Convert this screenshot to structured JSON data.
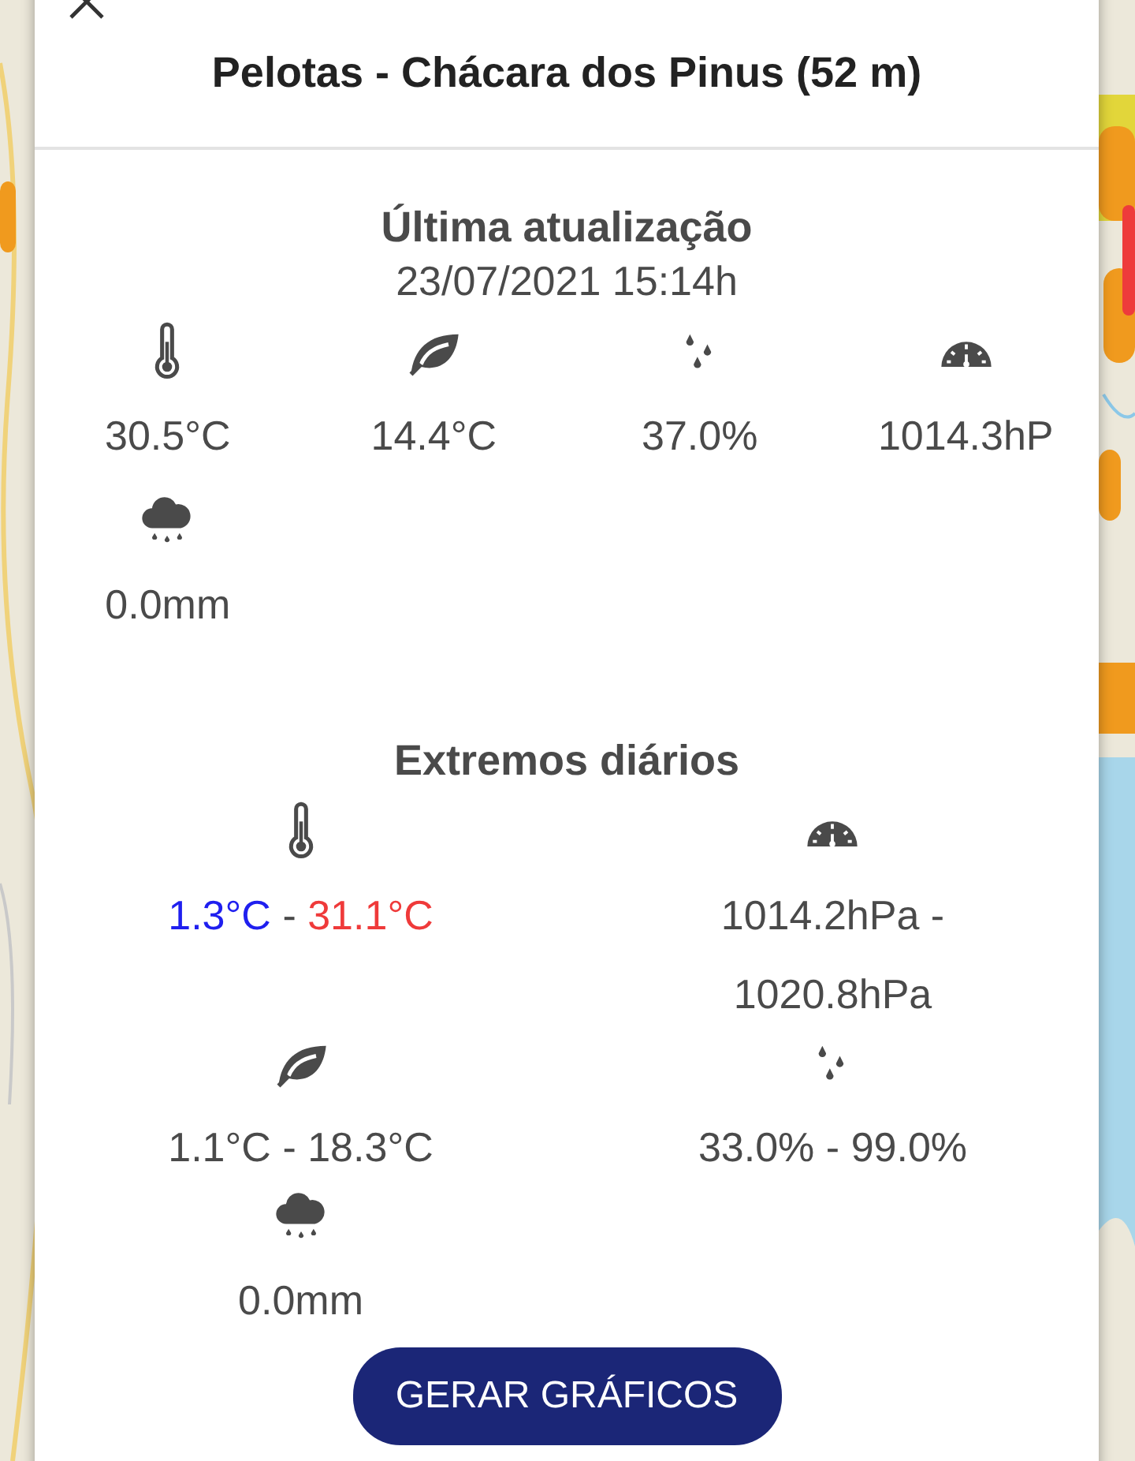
{
  "title": "Pelotas - Chácara dos Pinus (52 m)",
  "current": {
    "heading": "Última atualização",
    "timestamp": "23/07/2021 15:14h",
    "readings": [
      {
        "kind": "temperature",
        "value": "30.5°C"
      },
      {
        "kind": "dew_point",
        "value": "14.4°C"
      },
      {
        "kind": "humidity",
        "value": "37.0%"
      },
      {
        "kind": "pressure",
        "value": "1014.3hP"
      },
      {
        "kind": "rain",
        "value": "0.0mm"
      }
    ]
  },
  "extremes": {
    "heading": "Extremos diários",
    "items": [
      {
        "kind": "temperature",
        "low": "1.3°C",
        "separator": "-",
        "high": "31.1°C",
        "colored": true
      },
      {
        "kind": "pressure",
        "low": "1014.2hPa",
        "separator": "-",
        "high": "1020.8hPa"
      },
      {
        "kind": "dew_point",
        "low": "1.1°C",
        "separator": "-",
        "high": "18.3°C"
      },
      {
        "kind": "humidity",
        "low": "33.0%",
        "separator": "-",
        "high": "99.0%"
      },
      {
        "kind": "rain",
        "low": "0.0mm"
      }
    ]
  },
  "button": "GERAR GRÁFICOS"
}
